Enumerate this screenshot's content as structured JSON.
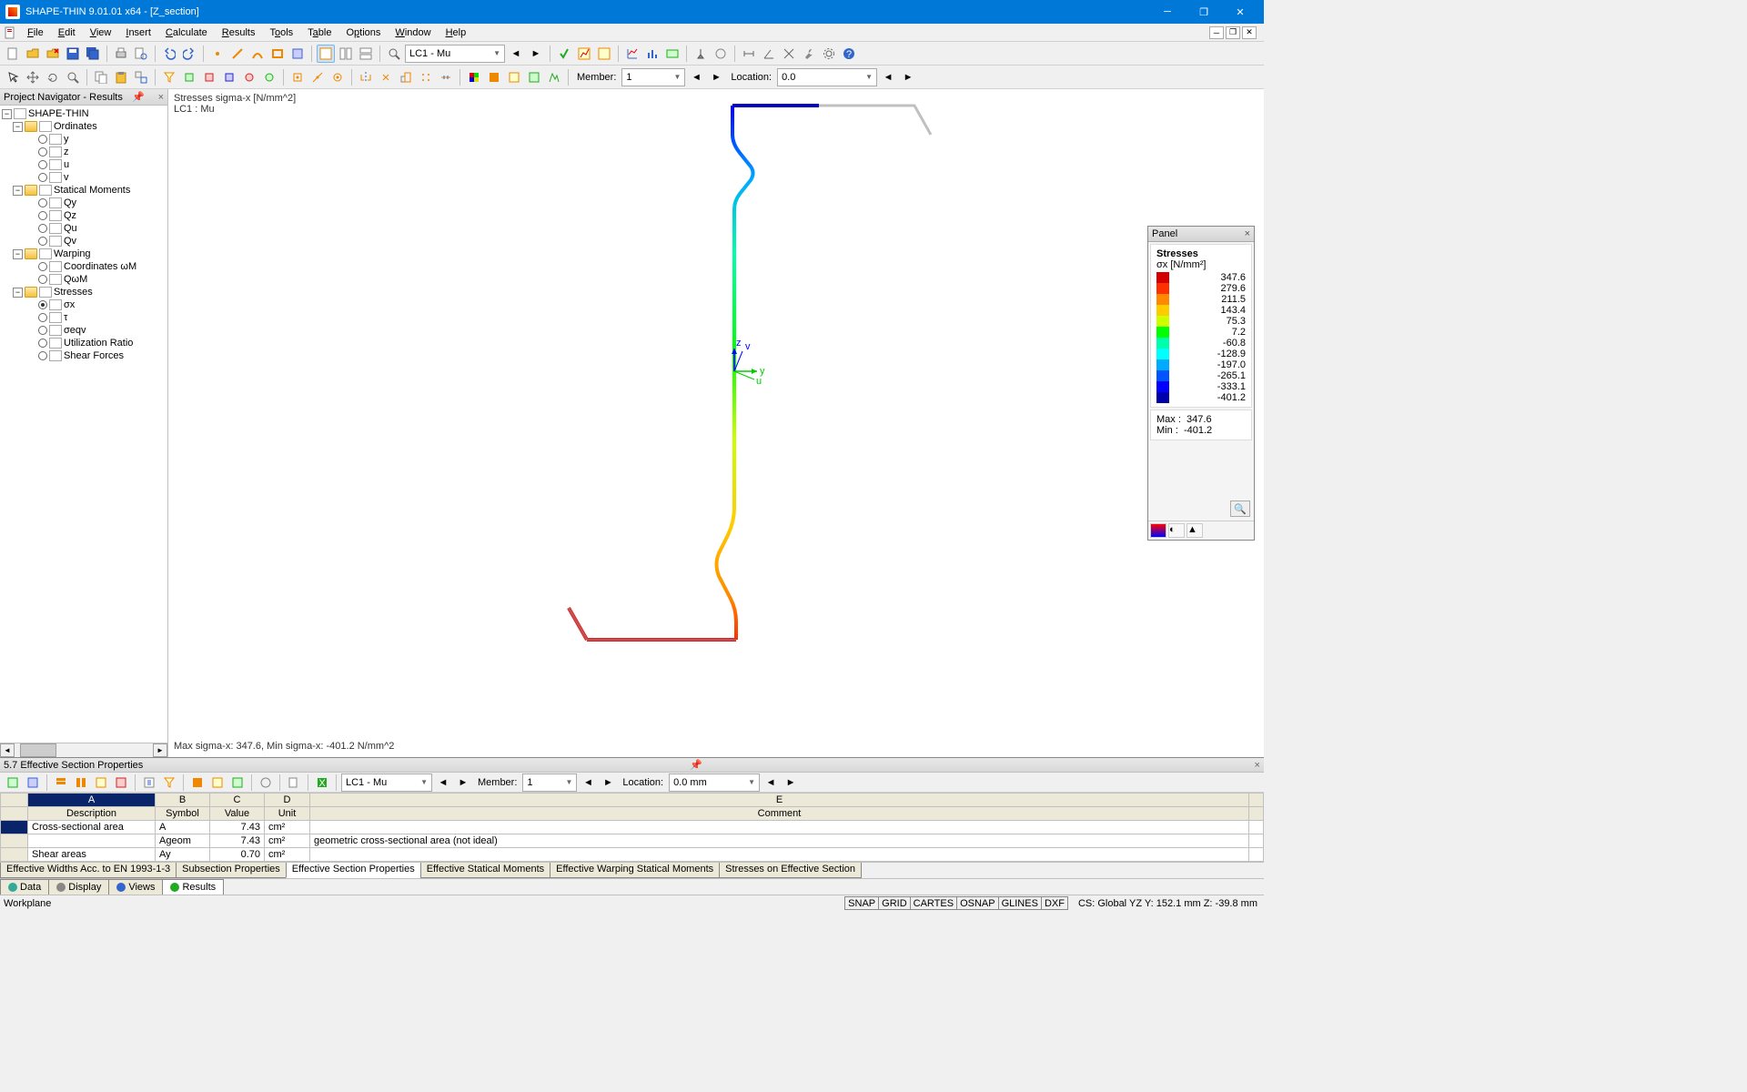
{
  "window": {
    "title": "SHAPE-THIN 9.01.01 x64 - [Z_section]"
  },
  "menu": [
    "File",
    "Edit",
    "View",
    "Insert",
    "Calculate",
    "Results",
    "Tools",
    "Table",
    "Options",
    "Window",
    "Help"
  ],
  "toolbar1": {
    "loadcase": "LC1 - Mu"
  },
  "toolbar2": {
    "member_label": "Member:",
    "member_value": "1",
    "location_label": "Location:",
    "location_value": "0.0"
  },
  "navigator": {
    "title": "Project Navigator - Results",
    "root": "SHAPE-THIN",
    "groups": [
      {
        "label": "Ordinates",
        "children": [
          "y",
          "z",
          "u",
          "v"
        ]
      },
      {
        "label": "Statical Moments",
        "children": [
          "Qy",
          "Qz",
          "Qu",
          "Qv"
        ]
      },
      {
        "label": "Warping",
        "children": [
          "Coordinates ωM",
          "QωM"
        ]
      },
      {
        "label": "Stresses",
        "children": [
          "σx",
          "τ",
          "σeqv",
          "Utilization Ratio",
          "Shear Forces"
        ],
        "selected": 0
      }
    ]
  },
  "viewport": {
    "title": "Stresses sigma-x [N/mm^2]",
    "subtitle": "LC1 : Mu",
    "footer": "Max sigma-x: 347.6, Min sigma-x: -401.2 N/mm^2",
    "axis_y": "y",
    "axis_z": "z",
    "axis_v": "v",
    "axis_u": "u"
  },
  "panel": {
    "title": "Panel",
    "heading": "Stresses",
    "unit": "σx [N/mm²]",
    "scale": [
      {
        "c": "#d40000",
        "v": "347.6"
      },
      {
        "c": "#ff3000",
        "v": "279.6"
      },
      {
        "c": "#ff8800",
        "v": "211.5"
      },
      {
        "c": "#ffcc00",
        "v": "143.4"
      },
      {
        "c": "#ccff00",
        "v": "75.3"
      },
      {
        "c": "#00ff00",
        "v": "7.2"
      },
      {
        "c": "#00ffaa",
        "v": "-60.8"
      },
      {
        "c": "#00ffff",
        "v": "-128.9"
      },
      {
        "c": "#00aaff",
        "v": "-197.0"
      },
      {
        "c": "#0055ff",
        "v": "-265.1"
      },
      {
        "c": "#0000ff",
        "v": "-333.1"
      },
      {
        "c": "#0000aa",
        "v": "-401.2"
      }
    ],
    "max_label": "Max :",
    "max_value": "347.6",
    "min_label": "Min :",
    "min_value": "-401.2"
  },
  "bottom": {
    "title": "5.7 Effective Section Properties",
    "loadcase": "LC1 - Mu",
    "member_label": "Member:",
    "member_value": "1",
    "location_label": "Location:",
    "location_value": "0.0 mm",
    "cols": [
      "A",
      "B",
      "C",
      "D",
      "E"
    ],
    "heads": [
      "Description",
      "Symbol",
      "Value",
      "Unit",
      "Comment"
    ],
    "rows": [
      {
        "desc": "Cross-sectional area",
        "sym": "A",
        "val": "7.43",
        "unit": "cm²",
        "comment": ""
      },
      {
        "desc": "",
        "sym": "Ageom",
        "val": "7.43",
        "unit": "cm²",
        "comment": "geometric cross-sectional area (not ideal)"
      },
      {
        "desc": "Shear areas",
        "sym": "Ay",
        "val": "0.70",
        "unit": "cm²",
        "comment": ""
      }
    ],
    "tabs": [
      "Effective Widths Acc. to EN 1993-1-3",
      "Subsection Properties",
      "Effective Section Properties",
      "Effective Statical Moments",
      "Effective Warping Statical Moments",
      "Stresses on Effective Section"
    ],
    "active_tab": 2
  },
  "view_tabs": [
    {
      "label": "Data",
      "icon": "#3a9"
    },
    {
      "label": "Display",
      "icon": "#888"
    },
    {
      "label": "Views",
      "icon": "#36c"
    },
    {
      "label": "Results",
      "icon": "#2a2"
    }
  ],
  "active_view_tab": 3,
  "status": {
    "left": "Workplane",
    "buttons": [
      "SNAP",
      "GRID",
      "CARTES",
      "OSNAP",
      "GLINES",
      "DXF"
    ],
    "coords": "CS: Global YZ Y:   152.1 mm    Z:   -39.8 mm"
  }
}
